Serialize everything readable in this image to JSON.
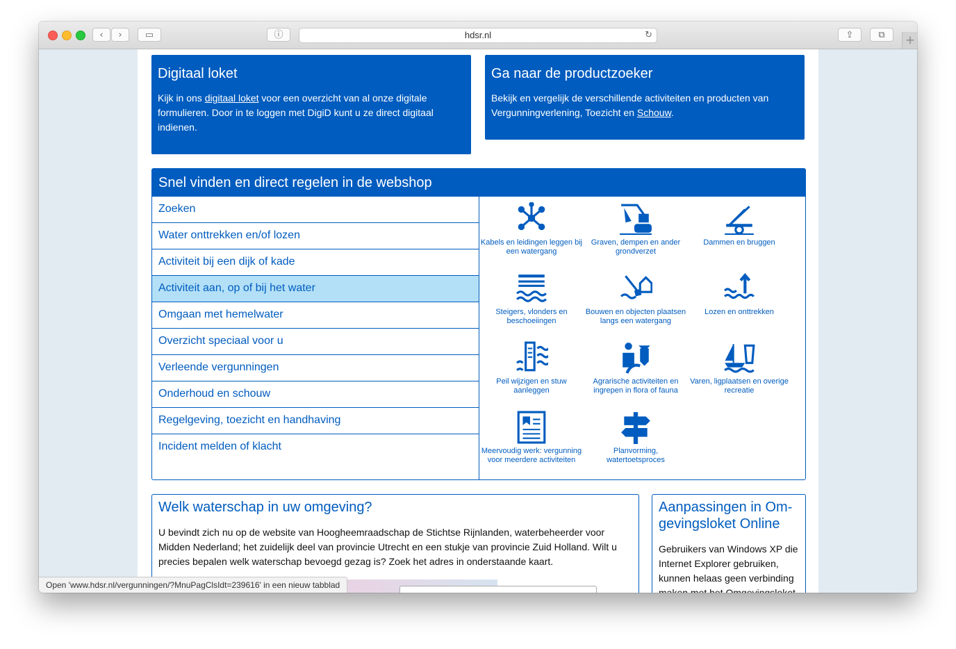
{
  "browser": {
    "url": "hdsr.nl",
    "back_icon": "‹",
    "forward_icon": "›",
    "sidebar_icon": "▭",
    "reader_icon": "ⓘ",
    "reload_icon": "↻",
    "share_icon": "⇪",
    "tabs_icon": "⧉",
    "new_tab_icon": "+"
  },
  "digitaal_loket": {
    "title": "Digitaal loket",
    "text_before": "Kijk in ons ",
    "link": "digitaal loket",
    "text_after": " voor een overzicht van al onze digitale formulieren. Door in te loggen met DigiD kunt u ze direct digitaal indienen."
  },
  "productzoeker": {
    "title": "Ga naar de productzoeker",
    "text_before": "Bekijk en vergelijk de verschillende activiteiten en producten van Vergunningverlening, Toezicht en ",
    "link": "Schouw",
    "text_after": "."
  },
  "webshop": {
    "title": "Snel vinden en direct regelen in de webshop",
    "active_index": 3,
    "items": [
      "Zoeken",
      "Water onttrekken en/of lozen",
      "Activiteit bij een dijk of kade",
      "Activiteit aan, op of bij het water",
      "Omgaan met hemelwater",
      "Overzicht speciaal voor u",
      "Verleende vergunningen",
      "Onderhoud en schouw",
      "Regelgeving, toezicht en handhaving",
      "Incident melden of klacht"
    ],
    "tiles": [
      {
        "label": "Kabels en leidingen leggen bij een watergang",
        "icon": "network-icon"
      },
      {
        "label": "Graven, dempen en ander grondverzet",
        "icon": "excavator-icon"
      },
      {
        "label": "Dammen en bruggen",
        "icon": "crane-icon"
      },
      {
        "label": "Steigers, vlonders en beschoeiingen",
        "icon": "jetty-icon"
      },
      {
        "label": "Bouwen en objecten plaatsen langs een watergang",
        "icon": "building-shovel-icon"
      },
      {
        "label": "Lozen en onttrekken",
        "icon": "water-arrow-icon"
      },
      {
        "label": "Peil wijzigen en stuw aanleggen",
        "icon": "water-level-icon"
      },
      {
        "label": "Agrarische activiteiten en ingrepen in flora of fauna",
        "icon": "farmer-cow-icon"
      },
      {
        "label": "Varen, ligplaatsen en overige recreatie",
        "icon": "boat-icon"
      },
      {
        "label": "Meervoudig werk: vergunning voor meerdere activiteiten",
        "icon": "document-icon"
      },
      {
        "label": "Planvorming, watertoetsproces",
        "icon": "signpost-icon"
      }
    ]
  },
  "waterschap": {
    "title": "Welk waterschap in uw omgeving?",
    "text": "U bevindt zich nu op de website van Hoogheemraadschap de Stichtse Rijnlanden, waterbeheerder voor Midden Nederland; het zuidelijk deel van provincie Utrecht en een stukje van provincie Zuid Holland. Wilt u precies bepalen welk waterschap bevoegd gezag is? Zoek het adres in onderstaande kaart."
  },
  "aanpassingen": {
    "title": "Aanpassingen in Om-gevingsloket Online",
    "text": "Gebruikers van Windows XP die Internet Explorer gebruiken, kunnen helaas geen verbinding maken met het Omgevingsloket"
  },
  "status": {
    "text": "Open 'www.hdsr.nl/vergunningen/?MnuPagClsIdt=239616' in een nieuw tabblad"
  },
  "colors": {
    "brand_blue": "#005cbf",
    "active_row": "#b3e0f7",
    "outer_bg": "#e2ebf2"
  }
}
